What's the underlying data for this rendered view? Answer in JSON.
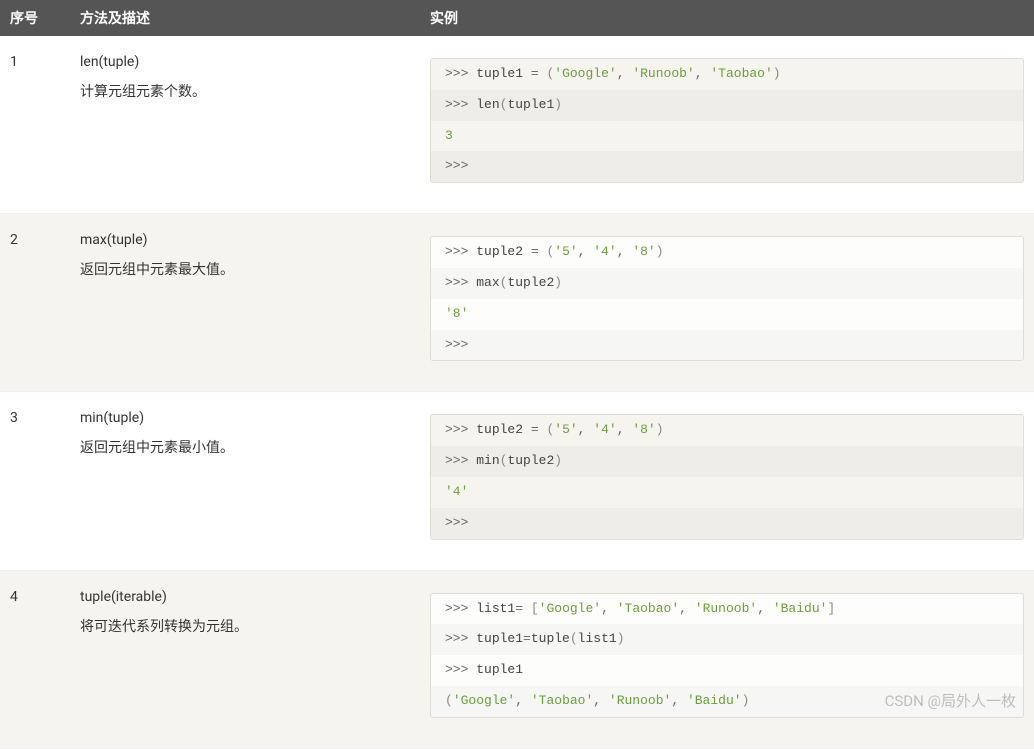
{
  "headers": {
    "num": "序号",
    "method": "方法及描述",
    "example": "实例"
  },
  "rows": [
    {
      "num": "1",
      "method": "len(tuple)",
      "desc": "计算元组元素个数。",
      "code": [
        [
          {
            "t": ">>> ",
            "c": "prompt"
          },
          {
            "t": "tuple1 ",
            "c": "kw"
          },
          {
            "t": "=",
            "c": "op"
          },
          {
            "t": " ",
            "c": ""
          },
          {
            "t": "(",
            "c": "paren"
          },
          {
            "t": "'Google'",
            "c": "str"
          },
          {
            "t": ",",
            "c": "op"
          },
          {
            "t": " ",
            "c": ""
          },
          {
            "t": "'Runoob'",
            "c": "str"
          },
          {
            "t": ",",
            "c": "op"
          },
          {
            "t": " ",
            "c": ""
          },
          {
            "t": "'Taobao'",
            "c": "str"
          },
          {
            "t": ")",
            "c": "paren"
          }
        ],
        [
          {
            "t": ">>> ",
            "c": "prompt"
          },
          {
            "t": "len",
            "c": "fn"
          },
          {
            "t": "(",
            "c": "paren"
          },
          {
            "t": "tuple1",
            "c": "kw"
          },
          {
            "t": ")",
            "c": "paren"
          }
        ],
        [
          {
            "t": "3",
            "c": "num"
          }
        ],
        [
          {
            "t": ">>>",
            "c": "prompt"
          }
        ]
      ]
    },
    {
      "num": "2",
      "method": "max(tuple)",
      "desc": "返回元组中元素最大值。",
      "code": [
        [
          {
            "t": ">>> ",
            "c": "prompt"
          },
          {
            "t": "tuple2 ",
            "c": "kw"
          },
          {
            "t": "=",
            "c": "op"
          },
          {
            "t": " ",
            "c": ""
          },
          {
            "t": "(",
            "c": "paren"
          },
          {
            "t": "'5'",
            "c": "str"
          },
          {
            "t": ",",
            "c": "op"
          },
          {
            "t": " ",
            "c": ""
          },
          {
            "t": "'4'",
            "c": "str"
          },
          {
            "t": ",",
            "c": "op"
          },
          {
            "t": " ",
            "c": ""
          },
          {
            "t": "'8'",
            "c": "str"
          },
          {
            "t": ")",
            "c": "paren"
          }
        ],
        [
          {
            "t": ">>> ",
            "c": "prompt"
          },
          {
            "t": "max",
            "c": "fn"
          },
          {
            "t": "(",
            "c": "paren"
          },
          {
            "t": "tuple2",
            "c": "kw"
          },
          {
            "t": ")",
            "c": "paren"
          }
        ],
        [
          {
            "t": "'8'",
            "c": "str"
          }
        ],
        [
          {
            "t": ">>>",
            "c": "prompt"
          }
        ]
      ]
    },
    {
      "num": "3",
      "method": "min(tuple)",
      "desc": "返回元组中元素最小值。",
      "code": [
        [
          {
            "t": ">>> ",
            "c": "prompt"
          },
          {
            "t": "tuple2 ",
            "c": "kw"
          },
          {
            "t": "=",
            "c": "op"
          },
          {
            "t": " ",
            "c": ""
          },
          {
            "t": "(",
            "c": "paren"
          },
          {
            "t": "'5'",
            "c": "str"
          },
          {
            "t": ",",
            "c": "op"
          },
          {
            "t": " ",
            "c": ""
          },
          {
            "t": "'4'",
            "c": "str"
          },
          {
            "t": ",",
            "c": "op"
          },
          {
            "t": " ",
            "c": ""
          },
          {
            "t": "'8'",
            "c": "str"
          },
          {
            "t": ")",
            "c": "paren"
          }
        ],
        [
          {
            "t": ">>> ",
            "c": "prompt"
          },
          {
            "t": "min",
            "c": "fn"
          },
          {
            "t": "(",
            "c": "paren"
          },
          {
            "t": "tuple2",
            "c": "kw"
          },
          {
            "t": ")",
            "c": "paren"
          }
        ],
        [
          {
            "t": "'4'",
            "c": "str"
          }
        ],
        [
          {
            "t": ">>>",
            "c": "prompt"
          }
        ]
      ]
    },
    {
      "num": "4",
      "method": "tuple(iterable)",
      "desc": "将可迭代系列转换为元组。",
      "code": [
        [
          {
            "t": ">>> ",
            "c": "prompt"
          },
          {
            "t": "list1",
            "c": "kw"
          },
          {
            "t": "=",
            "c": "op"
          },
          {
            "t": " ",
            "c": ""
          },
          {
            "t": "[",
            "c": "paren"
          },
          {
            "t": "'Google'",
            "c": "str"
          },
          {
            "t": ",",
            "c": "op"
          },
          {
            "t": " ",
            "c": ""
          },
          {
            "t": "'Taobao'",
            "c": "str"
          },
          {
            "t": ",",
            "c": "op"
          },
          {
            "t": " ",
            "c": ""
          },
          {
            "t": "'Runoob'",
            "c": "str"
          },
          {
            "t": ",",
            "c": "op"
          },
          {
            "t": " ",
            "c": ""
          },
          {
            "t": "'Baidu'",
            "c": "str"
          },
          {
            "t": "]",
            "c": "paren"
          }
        ],
        [
          {
            "t": ">>> ",
            "c": "prompt"
          },
          {
            "t": "tuple1",
            "c": "kw"
          },
          {
            "t": "=",
            "c": "op"
          },
          {
            "t": "tuple",
            "c": "fn"
          },
          {
            "t": "(",
            "c": "paren"
          },
          {
            "t": "list1",
            "c": "kw"
          },
          {
            "t": ")",
            "c": "paren"
          }
        ],
        [
          {
            "t": ">>> ",
            "c": "prompt"
          },
          {
            "t": "tuple1",
            "c": "kw"
          }
        ],
        [
          {
            "t": "(",
            "c": "paren"
          },
          {
            "t": "'Google'",
            "c": "str"
          },
          {
            "t": ",",
            "c": "op"
          },
          {
            "t": " ",
            "c": ""
          },
          {
            "t": "'Taobao'",
            "c": "str"
          },
          {
            "t": ",",
            "c": "op"
          },
          {
            "t": " ",
            "c": ""
          },
          {
            "t": "'Runoob'",
            "c": "str"
          },
          {
            "t": ",",
            "c": "op"
          },
          {
            "t": " ",
            "c": ""
          },
          {
            "t": "'Baidu'",
            "c": "str"
          },
          {
            "t": ")",
            "c": "paren"
          }
        ]
      ]
    }
  ],
  "watermark": "CSDN @局外人一枚"
}
